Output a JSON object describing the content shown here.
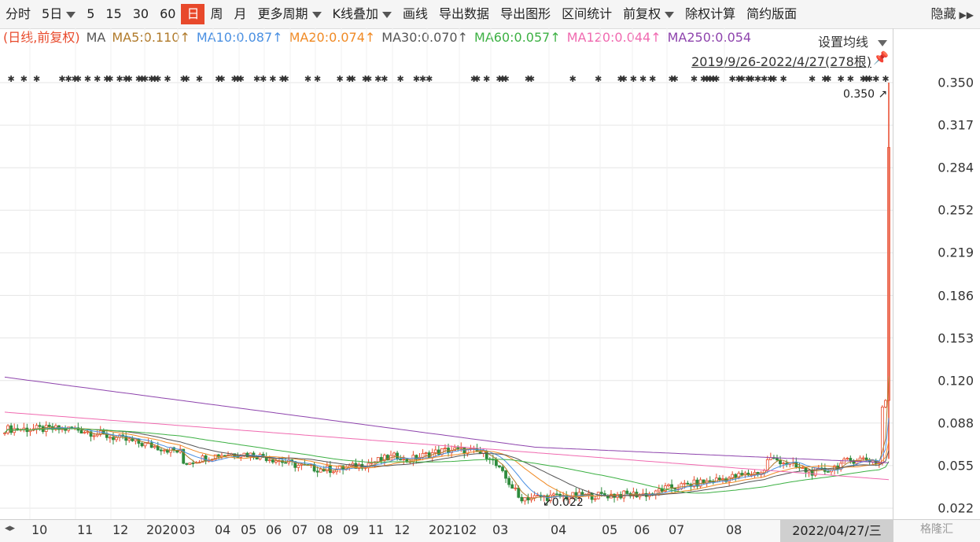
{
  "toolbar": {
    "items": [
      "分时",
      "5日",
      "5",
      "15",
      "30",
      "60",
      "日",
      "周",
      "月",
      "更多周期",
      "K线叠加",
      "画线",
      "导出数据",
      "导出图形",
      "区间统计",
      "前复权",
      "除权计算",
      "简约版面"
    ],
    "active": "日",
    "hide_label": "隐藏"
  },
  "ma_legend": {
    "mode": "(日线,前复权)",
    "ma_label": "MA",
    "items": [
      {
        "text": "MA5:0.110↑",
        "color": "#b07a2a"
      },
      {
        "text": "MA10:0.087↑",
        "color": "#4a90e2"
      },
      {
        "text": "MA20:0.074↑",
        "color": "#f08a24"
      },
      {
        "text": "MA30:0.070↑",
        "color": "#555555"
      },
      {
        "text": "MA60:0.057↑",
        "color": "#3cb043"
      },
      {
        "text": "MA120:0.044↑",
        "color": "#f06ab0"
      },
      {
        "text": "MA250:0.054",
        "color": "#8e44ad"
      }
    ],
    "mode_color": "#e8492b"
  },
  "settings": {
    "set_ma_label": "设置均线",
    "range_label": "2019/9/26-2022/4/27(278根)",
    "pin_icon": "pin-icon"
  },
  "chart_data": {
    "type": "candlestick",
    "range": "2019/9/26-2022/4/27",
    "bar_count": 278,
    "ylim": [
      0.022,
      0.35
    ],
    "y_ticks": [
      "0.350",
      "0.317",
      "0.284",
      "0.252",
      "0.219",
      "0.186",
      "0.153",
      "0.120",
      "0.088",
      "0.055",
      "0.022"
    ],
    "x_ticks": [
      {
        "label": "10",
        "x": 52
      },
      {
        "label": "11",
        "x": 110
      },
      {
        "label": "12",
        "x": 155
      },
      {
        "label": "2020",
        "x": 198
      },
      {
        "label": "03",
        "x": 240
      },
      {
        "label": "04",
        "x": 285
      },
      {
        "label": "05",
        "x": 318
      },
      {
        "label": "06",
        "x": 350
      },
      {
        "label": "07",
        "x": 383
      },
      {
        "label": "08",
        "x": 415
      },
      {
        "label": "09",
        "x": 448
      },
      {
        "label": "11",
        "x": 480
      },
      {
        "label": "12",
        "x": 513
      },
      {
        "label": "2021",
        "x": 557
      },
      {
        "label": "02",
        "x": 598
      },
      {
        "label": "03",
        "x": 638
      },
      {
        "label": "04",
        "x": 712
      },
      {
        "label": "05",
        "x": 777
      },
      {
        "label": "06",
        "x": 818
      },
      {
        "label": "07",
        "x": 862
      },
      {
        "label": "08",
        "x": 935
      }
    ],
    "cursor_date": "2022/04/27/三",
    "high_annotation": "0.350",
    "low_annotation": "0.022",
    "ma_colors": {
      "ma5": "#b07a2a",
      "ma10": "#4a90e2",
      "ma20": "#f08a24",
      "ma30": "#555555",
      "ma60": "#3cb043",
      "ma120": "#f06ab0",
      "ma250": "#8e44ad"
    },
    "up_color": "#e8492b",
    "down_color": "#2e8b3d"
  },
  "date_axis": {
    "nav_icon": "scroll-arrows-icon",
    "cursor": "2022/04/27/三"
  },
  "watermark": "格隆汇"
}
